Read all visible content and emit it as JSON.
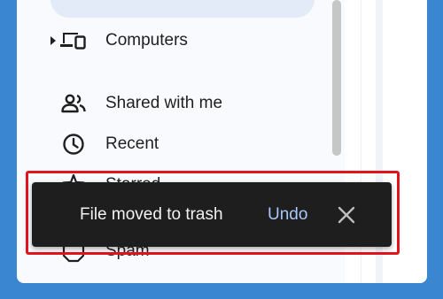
{
  "sidebar": {
    "items": [
      {
        "label": "Computers",
        "icon": "computers-icon"
      },
      {
        "label": "Shared with me",
        "icon": "people-icon"
      },
      {
        "label": "Recent",
        "icon": "clock-icon"
      },
      {
        "label": "Starred",
        "icon": "star-icon"
      },
      {
        "label": "Spam",
        "icon": "spam-icon"
      }
    ]
  },
  "snackbar": {
    "message": "File moved to trash",
    "action_label": "Undo",
    "close_icon": "close-icon"
  },
  "colors": {
    "background": "#3a86d0",
    "snackbar_bg": "#1e1e1e",
    "action_text": "#a8c7fa",
    "highlight": "#e2141e"
  }
}
